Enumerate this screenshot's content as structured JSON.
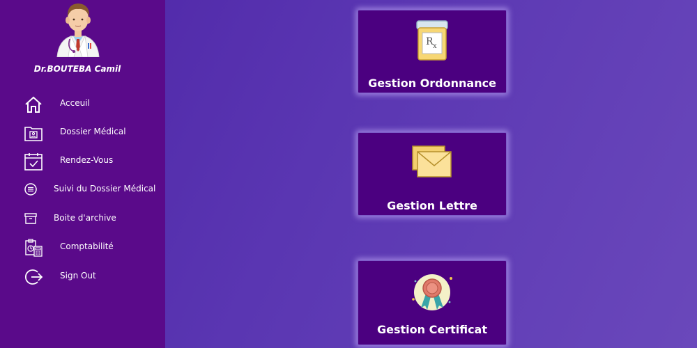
{
  "user": {
    "name": "Dr.BOUTEBA Camil"
  },
  "sidebar": {
    "items": [
      {
        "label": "Acceuil",
        "icon": "home-icon"
      },
      {
        "label": "Dossier Médical",
        "icon": "medical-folder-icon"
      },
      {
        "label": "Rendez-Vous",
        "icon": "calendar-check-icon"
      },
      {
        "label": "Suivi du Dossier Médical",
        "icon": "list-circle-icon"
      },
      {
        "label": "Boite d'archive",
        "icon": "archive-box-icon"
      },
      {
        "label": "Comptabilité",
        "icon": "accounting-calculator-icon"
      },
      {
        "label": "Sign Out",
        "icon": "sign-out-icon"
      }
    ]
  },
  "cards": [
    {
      "title": "Gestion Ordonnance",
      "icon": "prescription-bottle-icon"
    },
    {
      "title": "Gestion Lettre",
      "icon": "envelope-icon"
    },
    {
      "title": "Gestion Certificat",
      "icon": "certificate-ribbon-icon"
    }
  ],
  "colors": {
    "sidebar_bg": "#5a0a8a",
    "card_bg": "#4b0080",
    "background": "#5a36b2",
    "card_glow": "#cdb9ff"
  }
}
